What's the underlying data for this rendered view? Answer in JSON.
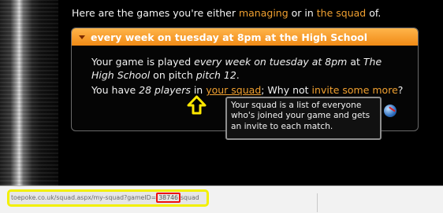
{
  "intro": {
    "prefix": "Here are the games you're either ",
    "managing_link": "managing",
    "middle": " or in ",
    "squad_link": "the squad",
    "suffix": " of."
  },
  "game_panel": {
    "header": "every week on tuesday at 8pm at the High School",
    "schedule": {
      "t1": "Your game is played ",
      "when": "every week on tuesday at 8pm",
      "t2": " at ",
      "venue": "The High School",
      "t3": " on pitch ",
      "pitch": "pitch 12",
      "t4": "."
    },
    "squad": {
      "t1": "You have ",
      "players": "28 players",
      "t2": " in ",
      "link": "your squad",
      "t3": "; Why not ",
      "invite_link": "invite some more",
      "t4": "?"
    }
  },
  "tooltip": "Your squad is a list of everyone who's joined your game and gets an invite to each match.",
  "status_bar": {
    "url_prefix": "toepoke.co.uk/squad.aspx/my-squad?gameID=",
    "game_id": "38746",
    "url_suffix": "squad"
  },
  "colors": {
    "accent": "#f0a030",
    "header": "#f4921e",
    "highlight_yellow": "#f2f000",
    "highlight_red": "#e11111"
  },
  "icons": [
    "globe-icon",
    "collapse-caret-icon",
    "up-arrow-annotation"
  ]
}
